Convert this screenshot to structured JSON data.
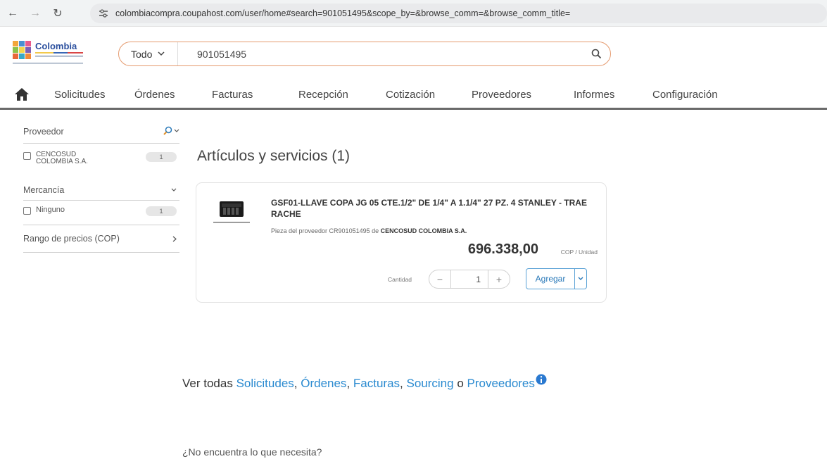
{
  "browser": {
    "url": "colombiacompra.coupahost.com/user/home#search=901051495&scope_by=&browse_comm=&browse_comm_title="
  },
  "header": {
    "logo_text": "Colombia",
    "search": {
      "scope": "Todo",
      "value": "901051495"
    }
  },
  "nav": {
    "items": [
      "Solicitudes",
      "Órdenes",
      "Facturas",
      "Recepción",
      "Cotización",
      "Proveedores",
      "Informes",
      "Configuración"
    ]
  },
  "sidebar": {
    "supplier": {
      "title": "Proveedor",
      "options": [
        {
          "label": "CENCOSUD COLOMBIA S.A.",
          "count": "1"
        }
      ]
    },
    "commodity": {
      "title": "Mercancía",
      "options": [
        {
          "label": "Ninguno",
          "count": "1"
        }
      ]
    },
    "price_range": {
      "title": "Rango de precios (COP)"
    }
  },
  "results": {
    "title": "Artículos y servicios (1)",
    "item": {
      "title": "GSF01-LLAVE COPA JG 05 CTE.1/2\" DE 1/4\" A 1.1/4\" 27 PZ. 4 STANLEY - TRAE RACHE",
      "part_prefix": "Pieza del proveedor CR901051495 de ",
      "supplier": "CENCOSUD COLOMBIA S.A.",
      "price": "696.338,00",
      "unit": "COP / Unidad",
      "quantity_label": "Cantidad",
      "quantity": "1",
      "add_label": "Agregar"
    }
  },
  "see_all": {
    "prefix": "Ver todas ",
    "links": [
      "Solicitudes",
      "Órdenes",
      "Facturas",
      "Sourcing",
      "Proveedores"
    ],
    "sep1": ", ",
    "sep2": ", ",
    "sep3": ", ",
    "or": " o "
  },
  "help_text": "¿No encuentra lo que necesita?",
  "colors": {
    "search_border": "#e59a6e",
    "link": "#2a8ad0",
    "button_border": "#5aa2d6"
  }
}
